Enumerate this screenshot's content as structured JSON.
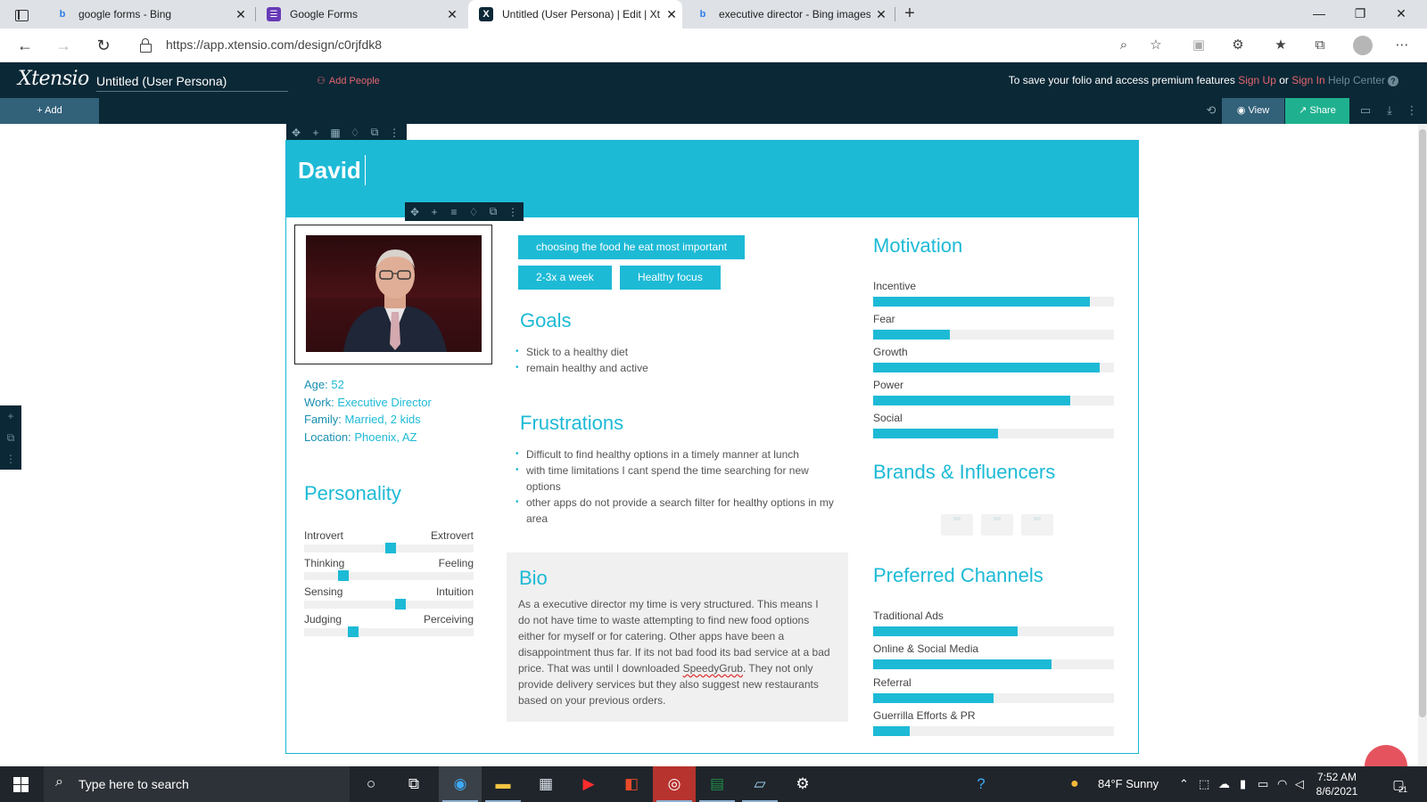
{
  "browser": {
    "tabs": [
      {
        "title": "google forms - Bing",
        "favicon": "bing-icon"
      },
      {
        "title": "Google Forms",
        "favicon": "google-forms-icon"
      },
      {
        "title": "Untitled (User Persona) | Edit | Xt",
        "favicon": "xtensio-icon"
      },
      {
        "title": "executive director - Bing images",
        "favicon": "bing-icon"
      }
    ],
    "url": "https://app.xtensio.com/design/c0rjfdk8"
  },
  "app": {
    "logo": "Xtensio",
    "doc_title": "Untitled (User Persona)",
    "add_people": "Add People",
    "save_msg": "To save your folio and access premium features",
    "sign_up": "Sign Up",
    "or": "or",
    "sign_in": "Sign In",
    "help": "Help Center",
    "add_btn": "+ Add",
    "view_btn": "View",
    "share_btn": "Share"
  },
  "persona": {
    "name": "David",
    "info": [
      {
        "label": "Age:",
        "value": "52"
      },
      {
        "label": "Work:",
        "value": "Executive Director"
      },
      {
        "label": "Family:",
        "value": "Married, 2 kids"
      },
      {
        "label": "Location:",
        "value": "Phoenix, AZ"
      }
    ],
    "personality_title": "Personality",
    "traits": [
      {
        "left": "Introvert",
        "right": "Extrovert",
        "level": 0.51
      },
      {
        "left": "Thinking",
        "right": "Feeling",
        "level": 0.23
      },
      {
        "left": "Sensing",
        "right": "Intuition",
        "level": 0.57
      },
      {
        "left": "Judging",
        "right": "Perceiving",
        "level": 0.29
      }
    ],
    "tags": [
      "choosing the food he eat most important",
      "2-3x a week",
      "Healthy focus"
    ],
    "goals_title": "Goals",
    "goals": [
      "Stick to a healthy diet",
      "remain healthy and active"
    ],
    "frustrations_title": "Frustrations",
    "frustrations": [
      "Difficult to find healthy options in a timely manner at lunch",
      "with time limitations I cant spend the time searching for new options",
      "other apps do not provide a search filter for healthy options in my area"
    ],
    "bio_title": "Bio",
    "bio_before": "As a executive director my time is very structured. This means I do not have time to waste attempting to find new food options either for myself or for catering. Other apps have been a disappointment thus far. If its not bad food its bad service at a bad price. That was until I downloaded ",
    "bio_spell": "SpeedyGrub",
    "bio_after": ". They not only provide delivery services but they also suggest new restaurants based on your previous orders.",
    "motivation_title": "Motivation",
    "motivation": [
      {
        "label": "Incentive",
        "level": 0.9
      },
      {
        "label": "Fear",
        "level": 0.32
      },
      {
        "label": "Growth",
        "level": 0.94
      },
      {
        "label": "Power",
        "level": 0.82
      },
      {
        "label": "Social",
        "level": 0.52
      }
    ],
    "brands_title": "Brands & Influencers",
    "channels_title": "Preferred Channels",
    "channels": [
      {
        "label": "Traditional Ads",
        "level": 0.6
      },
      {
        "label": "Online & Social Media",
        "level": 0.74
      },
      {
        "label": "Referral",
        "level": 0.5
      },
      {
        "label": "Guerrilla Efforts & PR",
        "level": 0.15
      }
    ]
  },
  "taskbar": {
    "search_placeholder": "Type here to search",
    "weather": "84°F  Sunny",
    "time": "7:52 AM",
    "date": "8/6/2021",
    "notif_count": "21"
  },
  "colors": {
    "accent": "#1dbad6",
    "header": "#0b2836",
    "share": "#1fb18f",
    "link_red": "#e5656f"
  }
}
